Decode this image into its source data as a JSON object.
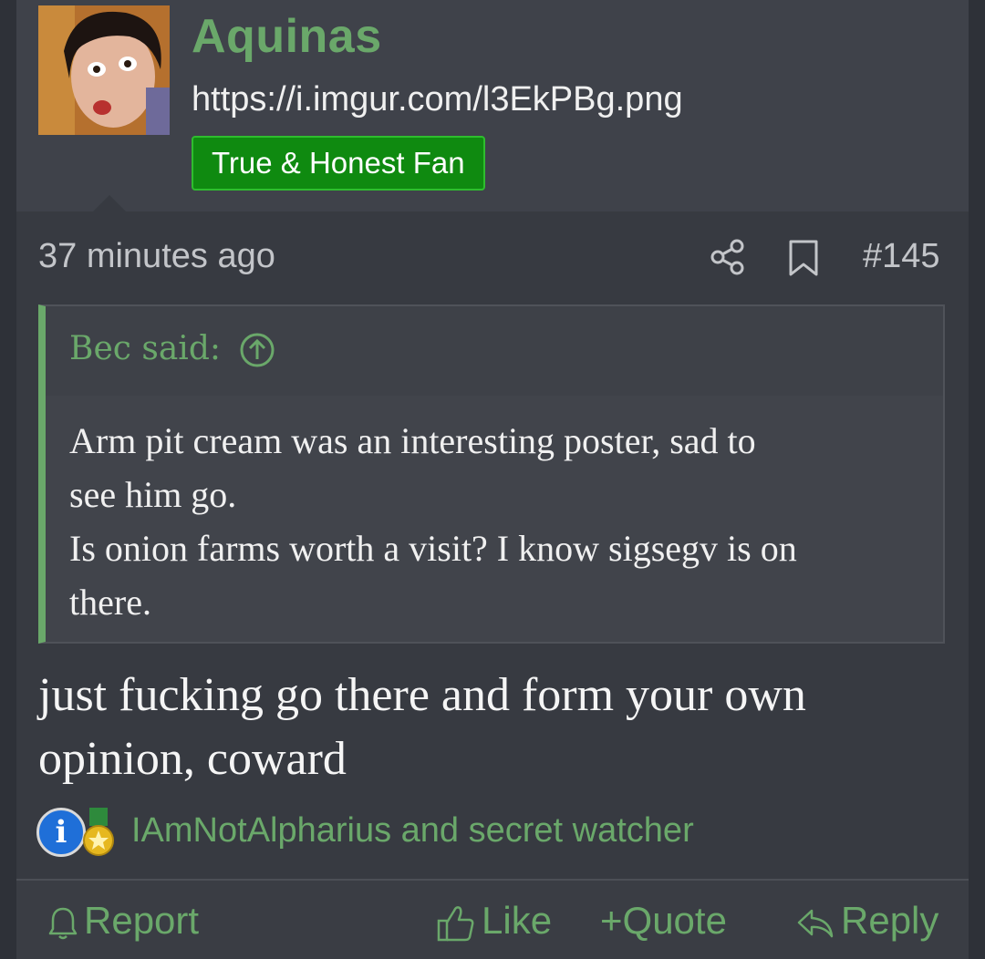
{
  "user": {
    "name": "Aquinas",
    "title": "https://i.imgur.com/l3EkPBg.png",
    "banner": "True & Honest Fan"
  },
  "post": {
    "time": "37 minutes ago",
    "number": "#145",
    "quote": {
      "author": "Bec said:",
      "lines": [
        "Arm pit cream was an interesting poster, sad to",
        "see him go.",
        "Is onion farms worth a visit? I know sigsegv is on",
        "there."
      ]
    },
    "reply_lines": [
      "just fucking go there and form your own",
      "opinion, coward"
    ],
    "reactions": {
      "info_glyph": "i",
      "names": "IAmNotAlpharius and secret watcher"
    }
  },
  "actions": {
    "report": "Report",
    "like": "Like",
    "quote": "Quote",
    "quote_prefix": "+",
    "reply": "Reply"
  },
  "colors": {
    "accent": "#6aa86a",
    "banner_bg": "#0f8a10",
    "background": "#3a3d44"
  }
}
